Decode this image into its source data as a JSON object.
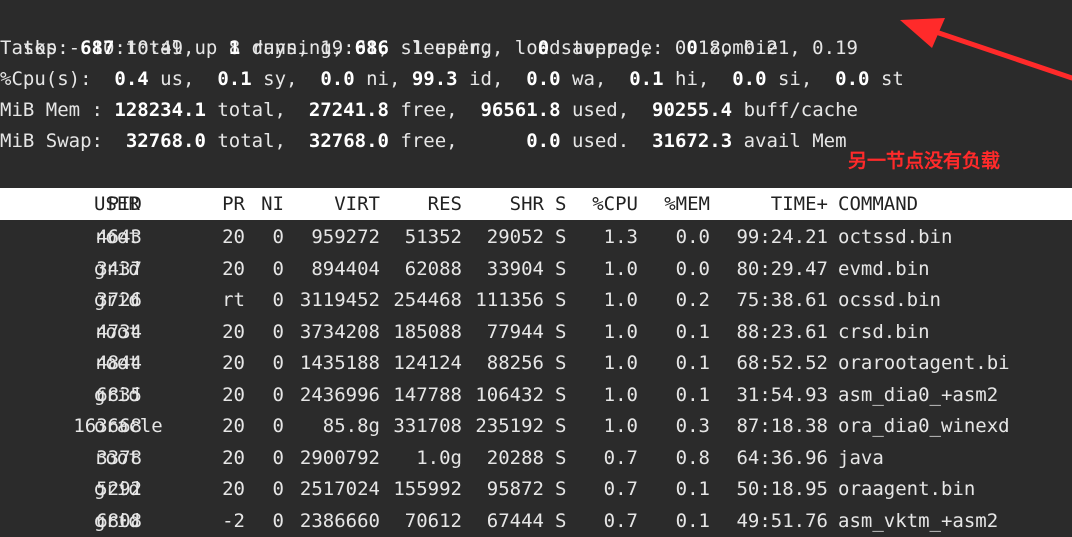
{
  "summary": {
    "line1": {
      "a": "top - 10:10:49 up 8 days, 19:01,  1 user,  load average: 0.18, 0.21, 0.19"
    },
    "tasks": {
      "label": "Tasks: ",
      "total": "687",
      "t_total": " total,   ",
      "running": "1",
      "t_running": " running, ",
      "sleeping": "686",
      "t_sleeping": " sleeping,   ",
      "stopped": "0",
      "t_stopped": " stopped,   ",
      "zombie": "0",
      "t_zombie": " zombie"
    },
    "cpu": {
      "label": "%Cpu(s):  ",
      "us": "0.4",
      "t_us": " us,  ",
      "sy": "0.1",
      "t_sy": " sy,  ",
      "ni": "0.0",
      "t_ni": " ni, ",
      "id": "99.3",
      "t_id": " id,  ",
      "wa": "0.0",
      "t_wa": " wa,  ",
      "hi": "0.1",
      "t_hi": " hi,  ",
      "si": "0.0",
      "t_si": " si,  ",
      "st": "0.0",
      "t_st": " st"
    },
    "mem": {
      "label": "MiB Mem : ",
      "total": "128234.1",
      "t_total": " total,  ",
      "free": "27241.8",
      "t_free": " free,  ",
      "used": "96561.8",
      "t_used": " used,  ",
      "buff": "90255.4",
      "t_buff": " buff/cache"
    },
    "swap": {
      "label": "MiB Swap:  ",
      "total": "32768.0",
      "t_total": " total,  ",
      "free": "32768.0",
      "t_free": " free,      ",
      "used": "0.0",
      "t_used": " used.  ",
      "avail": "31672.3",
      "t_avail": " avail Mem"
    }
  },
  "annotation": {
    "text": "另一节点没有负载",
    "color": "#ff2a2a"
  },
  "table": {
    "headers": [
      "PID",
      "USER",
      "PR",
      "NI",
      "VIRT",
      "RES",
      "SHR",
      "S",
      "%CPU",
      "%MEM",
      "TIME+",
      "COMMAND"
    ],
    "rows": [
      [
        "4643",
        "root",
        "20",
        "0",
        "959272",
        "51352",
        "29052",
        "S",
        "1.3",
        "0.0",
        "99:24.21",
        "octssd.bin"
      ],
      [
        "3437",
        "grid",
        "20",
        "0",
        "894404",
        "62088",
        "33904",
        "S",
        "1.0",
        "0.0",
        "80:29.47",
        "evmd.bin"
      ],
      [
        "3726",
        "grid",
        "rt",
        "0",
        "3119452",
        "254468",
        "111356",
        "S",
        "1.0",
        "0.2",
        "75:38.61",
        "ocssd.bin"
      ],
      [
        "4734",
        "root",
        "20",
        "0",
        "3734208",
        "185088",
        "77944",
        "S",
        "1.0",
        "0.1",
        "88:23.61",
        "crsd.bin"
      ],
      [
        "4844",
        "root",
        "20",
        "0",
        "1435188",
        "124124",
        "88256",
        "S",
        "1.0",
        "0.1",
        "68:52.52",
        "orarootagent.bi"
      ],
      [
        "6835",
        "grid",
        "20",
        "0",
        "2436996",
        "147788",
        "106432",
        "S",
        "1.0",
        "0.1",
        "31:54.93",
        "asm_dia0_+asm2"
      ],
      [
        "163668",
        "oracle",
        "20",
        "0",
        "85.8g",
        "331708",
        "235192",
        "S",
        "1.0",
        "0.3",
        "87:18.38",
        "ora_dia0_winexd"
      ],
      [
        "3378",
        "root",
        "20",
        "0",
        "2900792",
        "1.0g",
        "20288",
        "S",
        "0.7",
        "0.8",
        "64:36.96",
        "java"
      ],
      [
        "5292",
        "grid",
        "20",
        "0",
        "2517024",
        "155992",
        "95872",
        "S",
        "0.7",
        "0.1",
        "50:18.95",
        "oraagent.bin"
      ],
      [
        "6808",
        "grid",
        "-2",
        "0",
        "2386660",
        "70612",
        "67444",
        "S",
        "0.7",
        "0.1",
        "49:51.76",
        "asm_vktm_+asm2"
      ]
    ]
  },
  "colors": {
    "background": "#2b2b2b",
    "text": "#e6e6e6",
    "header_bg": "#ffffff",
    "arrow": "#ff2a2a"
  }
}
